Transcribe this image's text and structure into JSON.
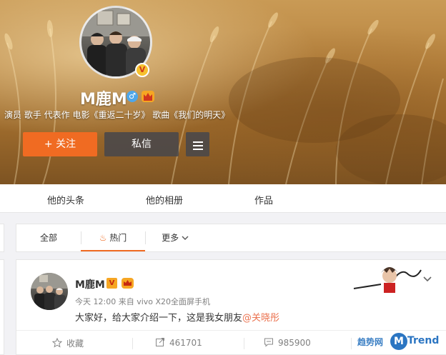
{
  "profile": {
    "name": "M鹿M",
    "bio": "演员 歌手 代表作 电影《重返二十岁》 歌曲《我们的明天》",
    "verified_badge": "V",
    "gender_icon": "♂",
    "vip_badge": "vip-icon"
  },
  "actions": {
    "follow_label": "+ 关注",
    "message_label": "私信",
    "more_icon": "menu-icon"
  },
  "profile_tabs": [
    {
      "label": "他的头条"
    },
    {
      "label": "他的相册"
    },
    {
      "label": "作品"
    }
  ],
  "feed_filters": {
    "all": "全部",
    "hot": "热门",
    "more": "更多",
    "active": "hot"
  },
  "post": {
    "author": "M鹿M",
    "meta": "今天 12:00 来自 vivo X20全面屏手机",
    "text": "大家好，给大家介绍一下，这是我女朋友",
    "mention": "@关晓彤",
    "actions": {
      "favorite": "收藏",
      "repost": "461701",
      "comment": "985900"
    }
  },
  "watermark": {
    "text1": "趋势网",
    "letter": "M",
    "text2": "Trend"
  },
  "colors": {
    "accent": "#f06b22",
    "mention": "#eb7350",
    "vip": "#f6a623"
  }
}
